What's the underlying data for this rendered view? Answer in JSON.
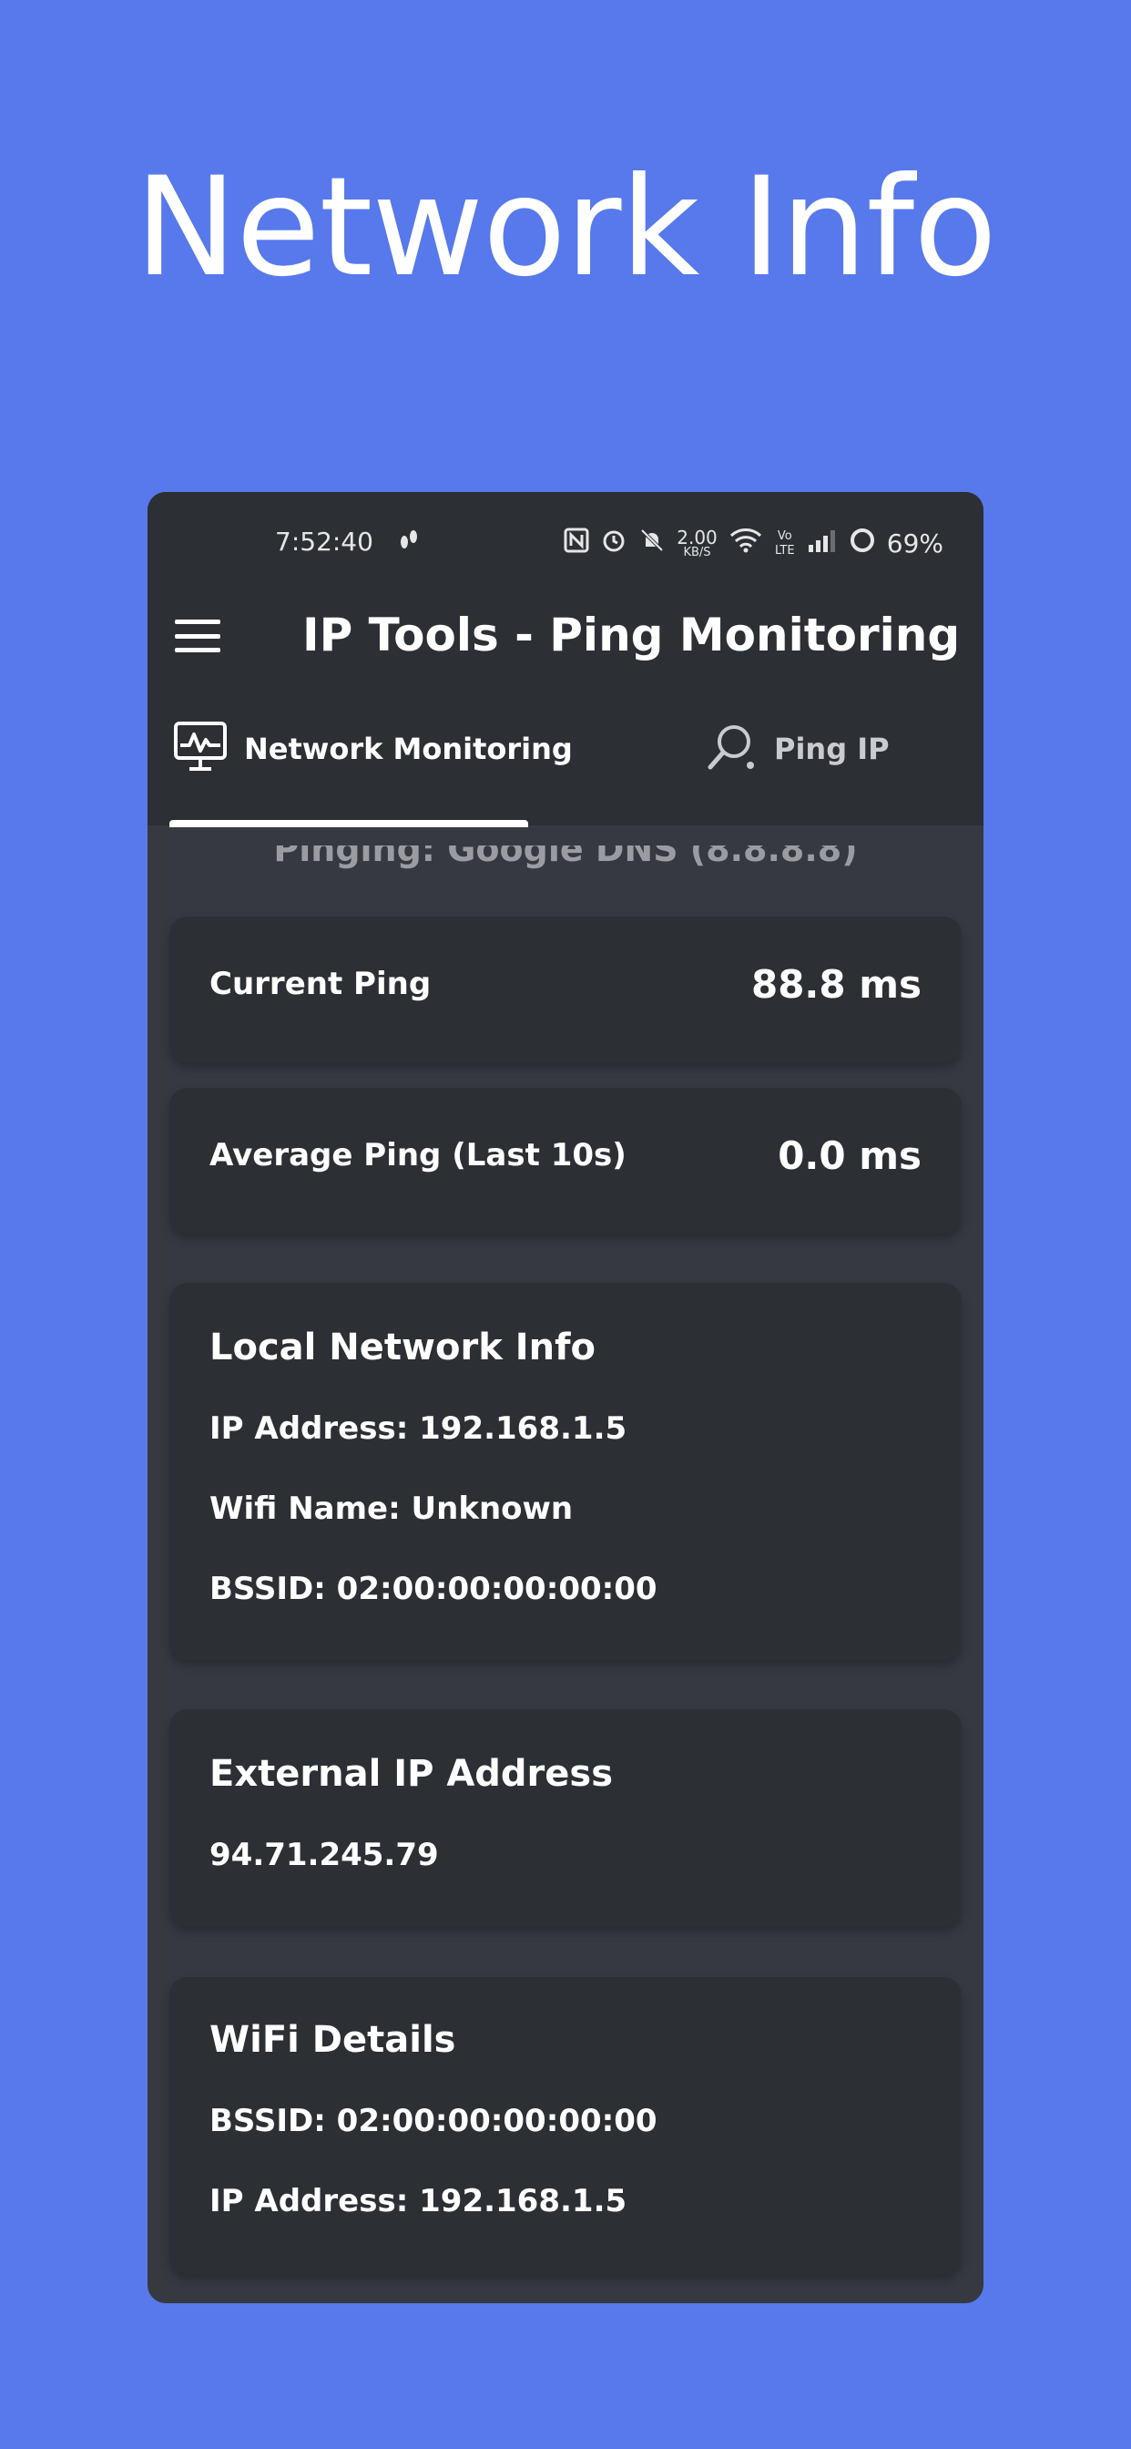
{
  "headline": "Network Info",
  "status_bar": {
    "time": "7:52:40",
    "net_speed_value": "2.00",
    "net_speed_unit": "KB/S",
    "volte": "Vo LTE",
    "battery": "69%"
  },
  "app_bar": {
    "title": "IP Tools - Ping Monitoring"
  },
  "tabs": [
    {
      "label": "Network Monitoring",
      "icon": "monitor-pulse-icon",
      "selected": true
    },
    {
      "label": "Ping IP",
      "icon": "magnifier-ping-icon",
      "selected": false
    }
  ],
  "pinging_text": "Pinging: Google DNS (8.8.8.8)",
  "current_ping": {
    "label": "Current Ping",
    "value": "88.8 ms"
  },
  "average_ping": {
    "label": "Average Ping (Last 10s)",
    "value": "0.0 ms"
  },
  "local_network": {
    "title": "Local Network Info",
    "ip": "IP Address: 192.168.1.5",
    "wifi_name": "Wifi Name: Unknown",
    "bssid": "BSSID: 02:00:00:00:00:00"
  },
  "external_ip": {
    "title": "External IP Address",
    "value": "94.71.245.79"
  },
  "wifi_details": {
    "title": "WiFi Details",
    "bssid": "BSSID: 02:00:00:00:00:00",
    "ip": "IP Address: 192.168.1.5"
  },
  "colors": {
    "background": "#5779ec",
    "app_surface": "#363940",
    "card": "#2c2f34"
  }
}
